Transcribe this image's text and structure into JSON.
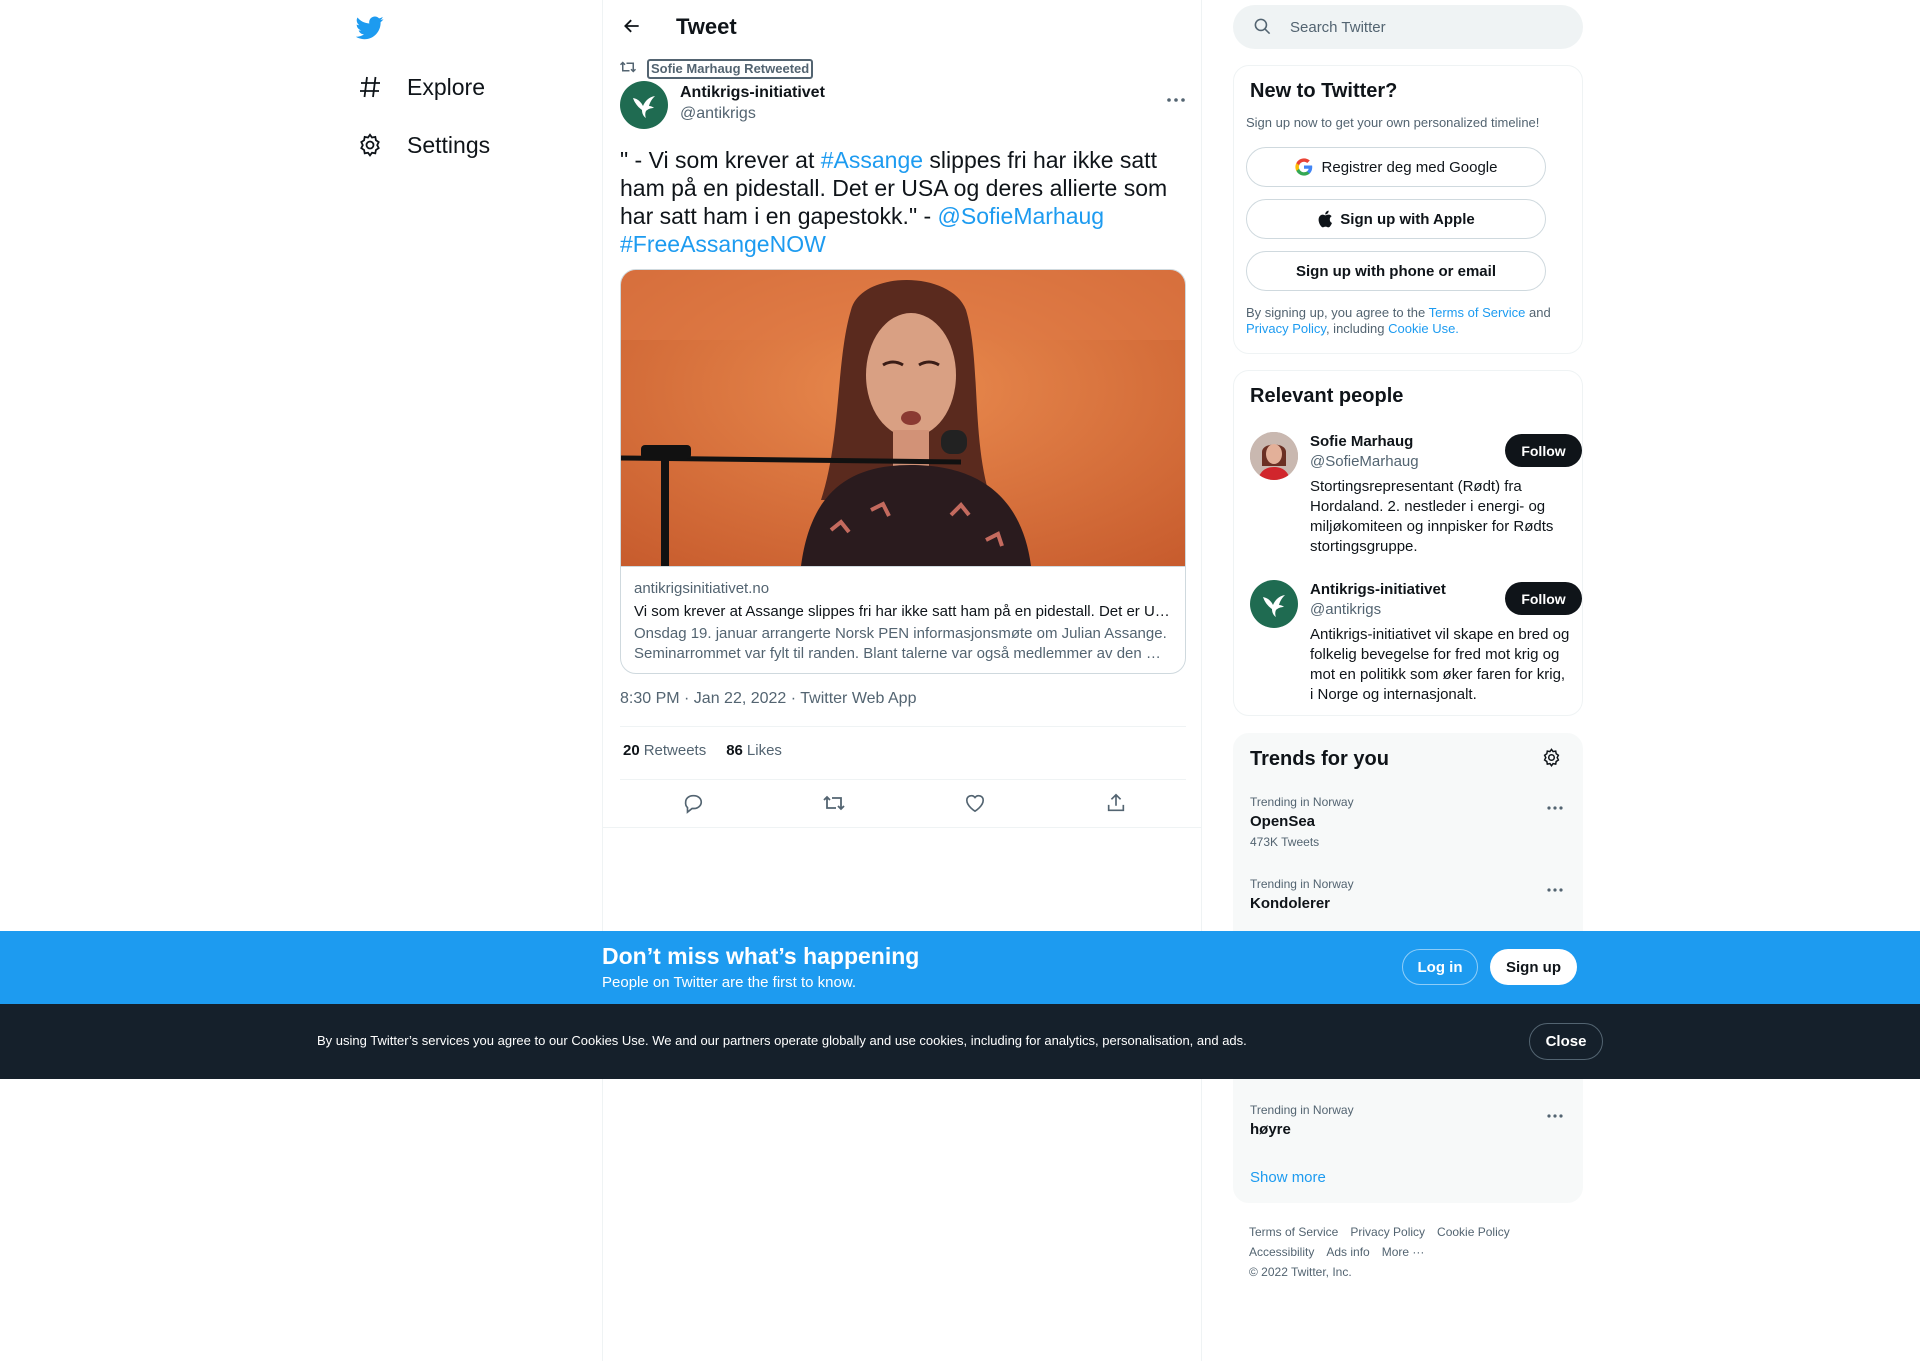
{
  "nav": {
    "logo_icon": "twitter-bird-icon",
    "items": [
      {
        "label": "Explore",
        "icon": "hashtag-icon"
      },
      {
        "label": "Settings",
        "icon": "gear-icon"
      }
    ]
  },
  "header": {
    "title": "Tweet",
    "back_icon": "arrow-left-icon"
  },
  "tweet": {
    "retweet_context": "Sofie Marhaug Retweeted",
    "author_name": "Antikrigs-initiativet",
    "author_handle": "@antikrigs",
    "text_parts": {
      "p1": "\" - Vi som krever at ",
      "hashtag1": "#Assange",
      "p2": " slippes fri har ikke satt ham på en pidestall. Det er USA og deres allierte som har satt ham i en gapestokk.\" - ",
      "mention": "@SofieMarhaug",
      "hashtag2": "#FreeAssangeNOW"
    },
    "card": {
      "domain": "antikrigsinitiativet.no",
      "title": "Vi som krever at Assange slippes fri har ikke satt ham på en pidestall. Det er USA og deres allierte som har satt ham i en gapestokk",
      "description": "Onsdag 19. januar arrangerte Norsk PEN informasjonsmøte om Julian Assange. Seminarrommet var fylt til randen. Blant talerne var også medlemmer av den …"
    },
    "timestamp": "8:30 PM · Jan 22, 2022 · Twitter Web App",
    "retweets_count": "20",
    "retweets_label": "Retweets",
    "likes_count": "86",
    "likes_label": "Likes"
  },
  "search": {
    "placeholder": "Search Twitter"
  },
  "signup_panel": {
    "title": "New to Twitter?",
    "subtitle": "Sign up now to get your own personalized timeline!",
    "google_label": "Registrer deg med Google",
    "apple_label": "Sign up with Apple",
    "phone_label": "Sign up with phone or email",
    "legal_prefix": "By signing up, you agree to the ",
    "terms": "Terms of Service",
    "and": " and ",
    "privacy": "Privacy Policy",
    "including": ", including ",
    "cookie": "Cookie Use."
  },
  "people": {
    "title": "Relevant people",
    "items": [
      {
        "name": "Sofie Marhaug",
        "handle": "@SofieMarhaug",
        "bio": "Stortingsrepresentant (Rødt) fra Hordaland. 2. nestleder i energi- og miljøkomiteen og innpisker for Rødts stortingsgruppe.",
        "follow": "Follow"
      },
      {
        "name": "Antikrigs-initiativet",
        "handle": "@antikrigs",
        "bio": "Antikrigs-initiativet vil skape en bred og folkelig bevegelse for fred mot krig og mot en politikk som øker faren for krig, i Norge og internasjonalt.",
        "follow": "Follow"
      }
    ]
  },
  "trends": {
    "title": "Trends for you",
    "items": [
      {
        "context": "Trending in Norway",
        "name": "OpenSea",
        "count": "473K Tweets"
      },
      {
        "context": "Trending in Norway",
        "name": "Kondolerer",
        "count": ""
      },
      {
        "context": "Trending in Norway",
        "name": "høyre",
        "count": ""
      }
    ],
    "show_more": "Show more"
  },
  "footer": {
    "terms": "Terms of Service",
    "privacy": "Privacy Policy",
    "cookie": "Cookie Policy",
    "accessibility": "Accessibility",
    "ads": "Ads info",
    "more": "More ···",
    "copyright": "© 2022 Twitter, Inc."
  },
  "signup_bar": {
    "title": "Don’t miss what’s happening",
    "subtitle": "People on Twitter are the first to know.",
    "login": "Log in",
    "signup": "Sign up"
  },
  "cookie_bar": {
    "text": "By using Twitter’s services you agree to our Cookies Use. We and our partners operate globally and use cookies, including for analytics, personalisation, and ads.",
    "close": "Close"
  },
  "colors": {
    "accent": "#1d9bf0",
    "text": "#0f1419",
    "secondary": "#536471",
    "cookie_bg": "#15202b"
  }
}
